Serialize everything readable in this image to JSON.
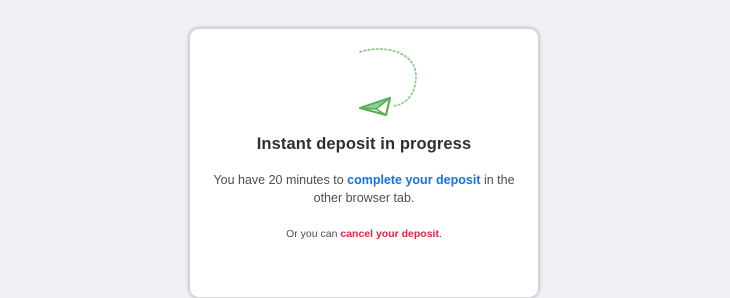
{
  "dialog": {
    "title": "Instant deposit in progress",
    "desc_before": "You have 20 minutes to ",
    "desc_link": "complete your deposit",
    "desc_after_line1": " in the",
    "desc_line2": "other browser tab.",
    "alt_before": "Or you can ",
    "alt_link": "cancel your deposit",
    "alt_after": ".",
    "icon": "paper-plane-icon"
  },
  "colors": {
    "background": "#f1f1f5",
    "card": "#ffffff",
    "title_text": "#2b2f38",
    "body_text": "#4a4e57",
    "link_blue": "#1473e6",
    "link_red": "#e5233e",
    "icon_green": "#5fb85f"
  }
}
